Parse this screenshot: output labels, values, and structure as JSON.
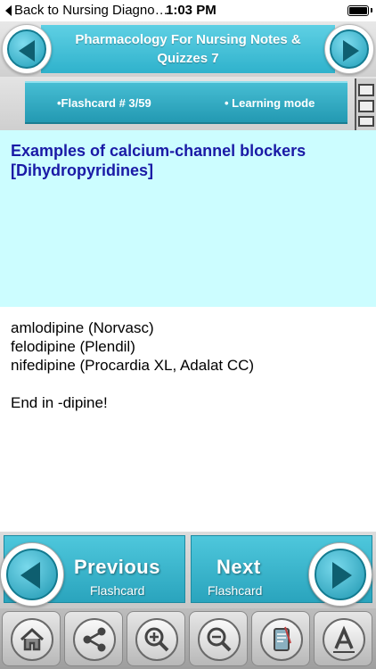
{
  "status_bar": {
    "back_label": "Back to Nursing Diagno…",
    "time": "1:03 PM"
  },
  "header": {
    "title": "Pharmacology For Nursing  Notes & Quizzes 7"
  },
  "info_bar": {
    "flashcard_counter": "•Flashcard #  3/59",
    "mode": "• Learning mode"
  },
  "card": {
    "question": "Examples of calcium-channel blockers [Dihydropyridines]",
    "answer_lines": [
      "amlodipine (Norvasc)",
      "felodipine (Plendil)",
      "nifedipine (Procardia XL, Adalat CC)",
      "",
      "End in -dipine!"
    ]
  },
  "navigation": {
    "previous_main": "Previous",
    "previous_sub": "Flashcard",
    "next_main": "Next",
    "next_sub": "Flashcard"
  },
  "colors": {
    "accent": "#2fb2cc",
    "question_bg": "#ccfdff",
    "question_text": "#1a1aa6"
  },
  "toolbar": {
    "icons": [
      "home-icon",
      "share-icon",
      "zoom-in-icon",
      "zoom-out-icon",
      "notes-icon",
      "font-icon"
    ]
  }
}
